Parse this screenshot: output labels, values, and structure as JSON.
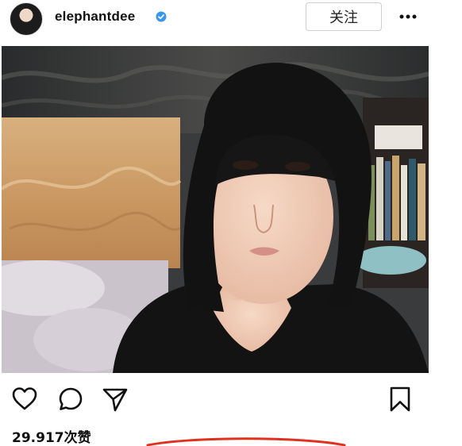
{
  "header": {
    "username": "elephantdee",
    "verified_icon": "verified-badge-icon",
    "follow_label": "关注",
    "more_icon": "more-icon"
  },
  "post": {
    "image_alt": "selfie photo",
    "actions": {
      "like_icon": "heart-icon",
      "comment_icon": "comment-icon",
      "share_icon": "send-icon",
      "save_icon": "bookmark-icon"
    },
    "likes_text": "29.917次赞"
  },
  "colors": {
    "verified": "#3897f0",
    "annotation": "#e0301e"
  }
}
